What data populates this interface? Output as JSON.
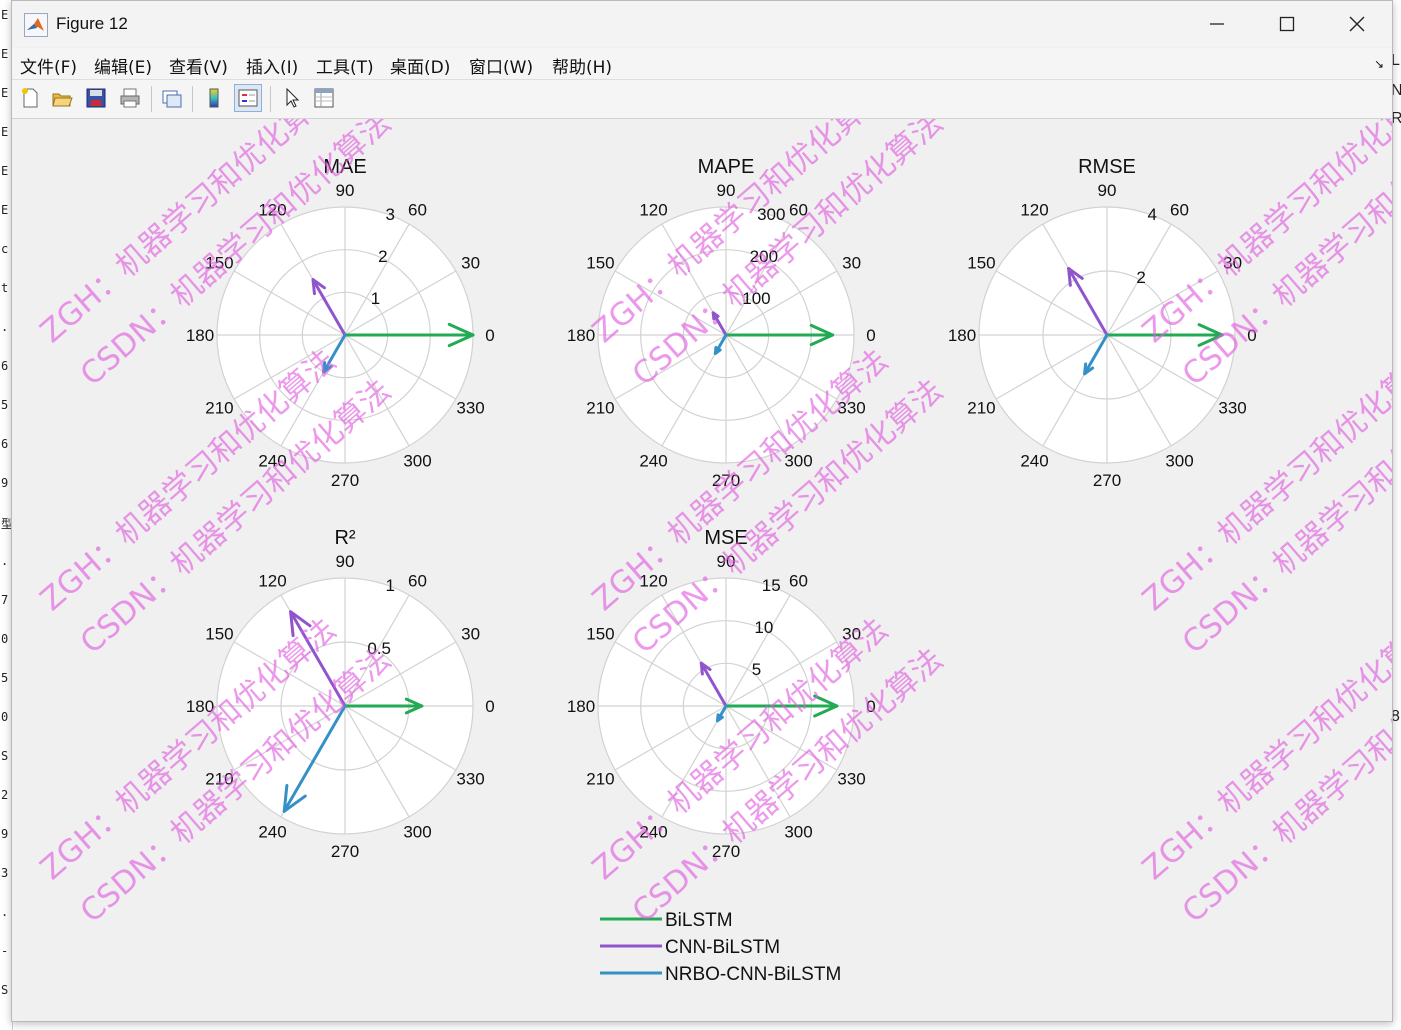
{
  "window": {
    "title": "Figure 12"
  },
  "background_left": {
    "chars": [
      "E",
      "E",
      "E",
      "E",
      "E",
      "E",
      "c",
      "t",
      ".",
      "6",
      "5",
      "6",
      "9",
      "型",
      ".",
      "7",
      "0",
      "5",
      "0",
      "S",
      "2",
      "9",
      "3",
      ".",
      "-",
      "S"
    ]
  },
  "background_right": {
    "chars": [
      "L",
      "N",
      "R",
      "8"
    ]
  },
  "menu": [
    {
      "label": "文件(F)"
    },
    {
      "label": "编辑(E)"
    },
    {
      "label": "查看(V)"
    },
    {
      "label": "插入(I)"
    },
    {
      "label": "工具(T)"
    },
    {
      "label": "桌面(D)"
    },
    {
      "label": "窗口(W)"
    },
    {
      "label": "帮助(H)"
    }
  ],
  "toolbar": {
    "icons": [
      "new-figure-icon",
      "open-file-icon",
      "save-icon",
      "print-icon",
      "link-plot-icon",
      "colorbar-icon",
      "legend-icon",
      "edit-plot-icon",
      "property-inspector-icon"
    ]
  },
  "colors": {
    "bilstm": "#22aa55",
    "cnn_bilstm": "#9055cc",
    "nrbo_cnn_bilstm": "#3590c8",
    "watermark": "#e05ae0",
    "grid": "#d2d2d2"
  },
  "angle_labels": [
    "0",
    "30",
    "60",
    "90",
    "120",
    "150",
    "180",
    "210",
    "240",
    "270",
    "300",
    "330"
  ],
  "chart_data": [
    {
      "type": "polar",
      "title": "MAE",
      "rlim": [
        0,
        3
      ],
      "rticks": [
        "1",
        "2",
        "3"
      ],
      "series": [
        {
          "name": "BiLSTM",
          "theta": 0,
          "r": 3.0
        },
        {
          "name": "CNN-BiLSTM",
          "theta": 120,
          "r": 1.5
        },
        {
          "name": "NRBO-CNN-BiLSTM",
          "theta": 240,
          "r": 1.0
        }
      ]
    },
    {
      "type": "polar",
      "title": "MAPE",
      "rlim": [
        0,
        300
      ],
      "rticks": [
        "100",
        "200",
        "300"
      ],
      "series": [
        {
          "name": "BiLSTM",
          "theta": 0,
          "r": 250
        },
        {
          "name": "CNN-BiLSTM",
          "theta": 120,
          "r": 60
        },
        {
          "name": "NRBO-CNN-BiLSTM",
          "theta": 240,
          "r": 50
        }
      ]
    },
    {
      "type": "polar",
      "title": "RMSE",
      "rlim": [
        0,
        4
      ],
      "rticks": [
        "2",
        "4"
      ],
      "series": [
        {
          "name": "BiLSTM",
          "theta": 0,
          "r": 3.6
        },
        {
          "name": "CNN-BiLSTM",
          "theta": 120,
          "r": 2.4
        },
        {
          "name": "NRBO-CNN-BiLSTM",
          "theta": 240,
          "r": 1.4
        }
      ]
    },
    {
      "type": "polar",
      "title": "R²",
      "rlim": [
        0,
        1
      ],
      "rticks": [
        "0.5",
        "1"
      ],
      "series": [
        {
          "name": "BiLSTM",
          "theta": 0,
          "r": 0.6
        },
        {
          "name": "CNN-BiLSTM",
          "theta": 120,
          "r": 0.85
        },
        {
          "name": "NRBO-CNN-BiLSTM",
          "theta": 240,
          "r": 0.95
        }
      ]
    },
    {
      "type": "polar",
      "title": "MSE",
      "rlim": [
        0,
        15
      ],
      "rticks": [
        "5",
        "10",
        "15"
      ],
      "series": [
        {
          "name": "BiLSTM",
          "theta": 0,
          "r": 13
        },
        {
          "name": "CNN-BiLSTM",
          "theta": 120,
          "r": 5.8
        },
        {
          "name": "NRBO-CNN-BiLSTM",
          "theta": 240,
          "r": 2.0
        }
      ]
    }
  ],
  "legend": {
    "entries": [
      "BiLSTM",
      "CNN-BiLSTM",
      "NRBO-CNN-BiLSTM"
    ]
  },
  "watermarks": [
    "ZGH：机器学习和优化算法",
    "CSDN：机器学习和优化算法"
  ]
}
